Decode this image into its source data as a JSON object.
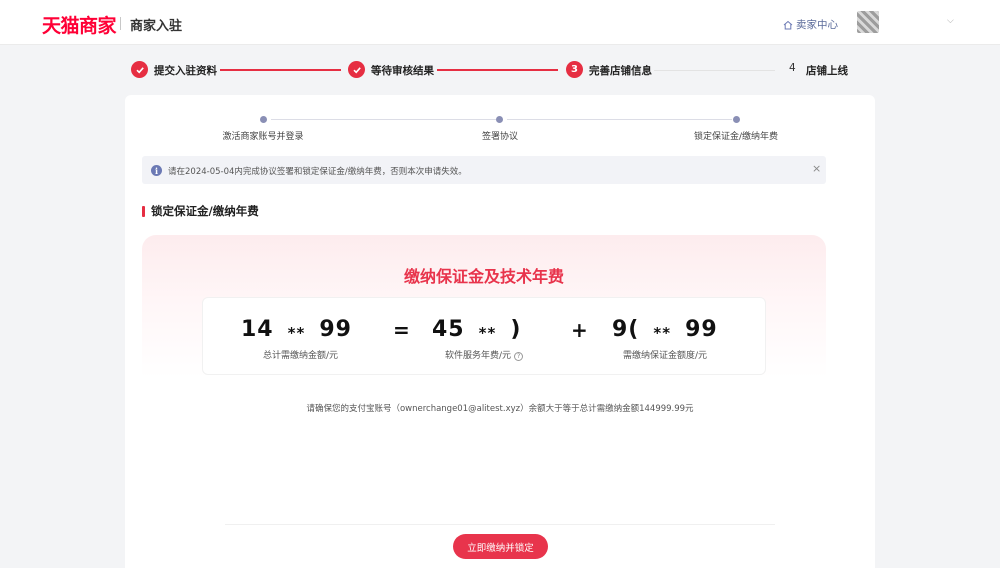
{
  "header": {
    "logo_text": "天猫商家",
    "subtitle": "商家入驻",
    "seller_center": "卖家中心",
    "icons": {
      "home": "home-icon",
      "caret": "chevron-down-icon"
    }
  },
  "steps": [
    {
      "label": "提交入驻资料",
      "status": "done"
    },
    {
      "label": "等待审核结果",
      "status": "done"
    },
    {
      "number": "3",
      "label": "完善店铺信息",
      "status": "active"
    },
    {
      "number": "4",
      "label": "店铺上线",
      "status": "pending"
    }
  ],
  "sub_steps": [
    {
      "label": "激活商家账号并登录"
    },
    {
      "label": "签署协议"
    },
    {
      "label": "锁定保证金/缴纳年费"
    }
  ],
  "alert": {
    "text": "请在2024-05-04内完成协议签署和锁定保证金/缴纳年费，否则本次申请失效。",
    "close": "×"
  },
  "section": {
    "title": "锁定保证金/缴纳年费"
  },
  "fee": {
    "title": "缴纳保证金及技术年费",
    "total": {
      "prefix": "14",
      "mask": "**",
      "suffix": "99",
      "label": "总计需缴纳金额/元"
    },
    "equals": "=",
    "software": {
      "prefix": "45",
      "mask": "**",
      "suffix": ")",
      "label": "软件服务年费/元"
    },
    "plus": "+",
    "deposit": {
      "prefix": "9(",
      "mask": "**",
      "suffix": "99",
      "label": "需缴纳保证金额度/元"
    },
    "help": "?"
  },
  "alipay_note": "请确保您的支付宝账号（ownerchange01@alitest.xyz）余额大于等于总计需缴纳金额144999.99元",
  "pay_button": "立即缴纳并锁定",
  "colors": {
    "accent": "#e62e42",
    "brand_red": "#ff0036",
    "sub_dot": "#8a8fb5"
  }
}
